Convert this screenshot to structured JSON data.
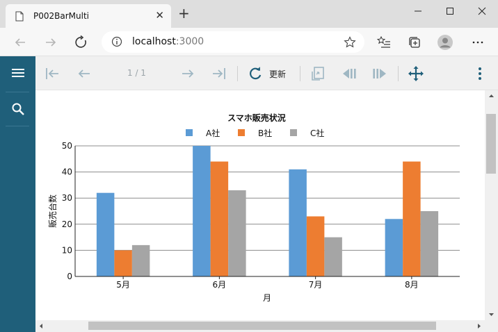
{
  "browser": {
    "tab_title": "P002BarMulti",
    "url_host": "localhost",
    "url_port": ":3000"
  },
  "toolbar": {
    "page_indicator": "1 / 1",
    "refresh_label": "更新"
  },
  "colors": {
    "sidebar": "#1f5f7a",
    "accent": "#1f5f7a",
    "series_a": "#5b9bd5",
    "series_b": "#ed7d31",
    "series_c": "#a5a5a5"
  },
  "icons": [
    "menu-icon",
    "search-icon",
    "first-page-icon",
    "prev-page-icon",
    "next-page-icon",
    "last-page-icon",
    "refresh-icon",
    "export-icon",
    "step-back-icon",
    "step-forward-icon",
    "move-icon",
    "more-vert-icon"
  ],
  "chart_data": {
    "type": "bar",
    "title": "スマホ販売状況",
    "xlabel": "月",
    "ylabel": "販売台数",
    "categories": [
      "5月",
      "6月",
      "7月",
      "8月"
    ],
    "series": [
      {
        "name": "A社",
        "values": [
          32,
          50,
          41,
          22
        ],
        "color": "#5b9bd5"
      },
      {
        "name": "B社",
        "values": [
          10,
          44,
          23,
          44
        ],
        "color": "#ed7d31"
      },
      {
        "name": "C社",
        "values": [
          12,
          33,
          15,
          25
        ],
        "color": "#a5a5a5"
      }
    ],
    "ylim": [
      0,
      50
    ],
    "yticks": [
      0,
      10,
      20,
      30,
      40,
      50
    ],
    "grid": true,
    "legend": "top"
  }
}
